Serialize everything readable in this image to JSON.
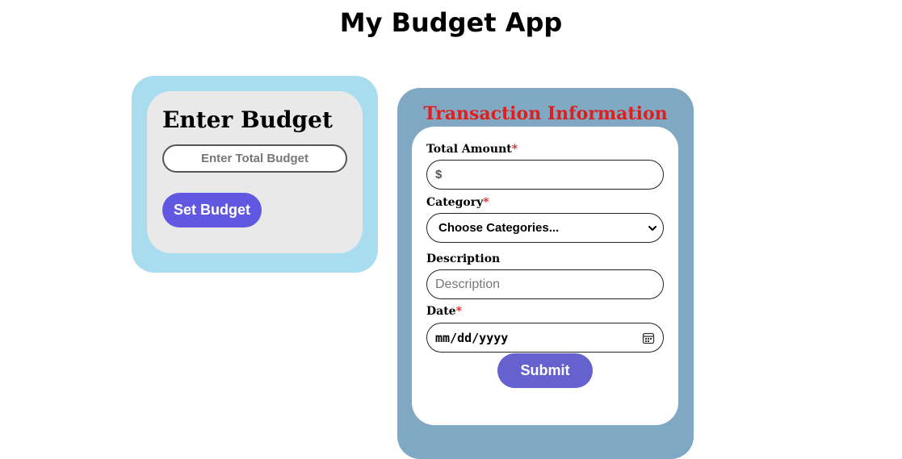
{
  "app": {
    "title": "My Budget App"
  },
  "budget": {
    "heading": "Enter Budget",
    "input_placeholder": "Enter Total Budget",
    "set_button_label": "Set Budget"
  },
  "transaction": {
    "heading": "Transaction Information",
    "amount": {
      "label": "Total Amount",
      "required_mark": "*",
      "currency_symbol": "$",
      "value": ""
    },
    "category": {
      "label": "Category",
      "required_mark": "*",
      "selected": "Choose Categories..."
    },
    "description": {
      "label": "Description",
      "placeholder": "Description"
    },
    "date": {
      "label": "Date",
      "required_mark": "*",
      "value": "mm/dd/yyyy"
    },
    "submit_label": "Submit"
  },
  "colors": {
    "budget_outer": "#aadcef",
    "budget_inner": "#e9e9ea",
    "set_button": "#6158e2",
    "tx_outer": "#80a8c2",
    "tx_heading": "#e01e1e",
    "submit_button": "#6562d0"
  },
  "icons": {
    "select_arrow": "chevron-down-icon",
    "date_picker": "calendar-icon"
  }
}
